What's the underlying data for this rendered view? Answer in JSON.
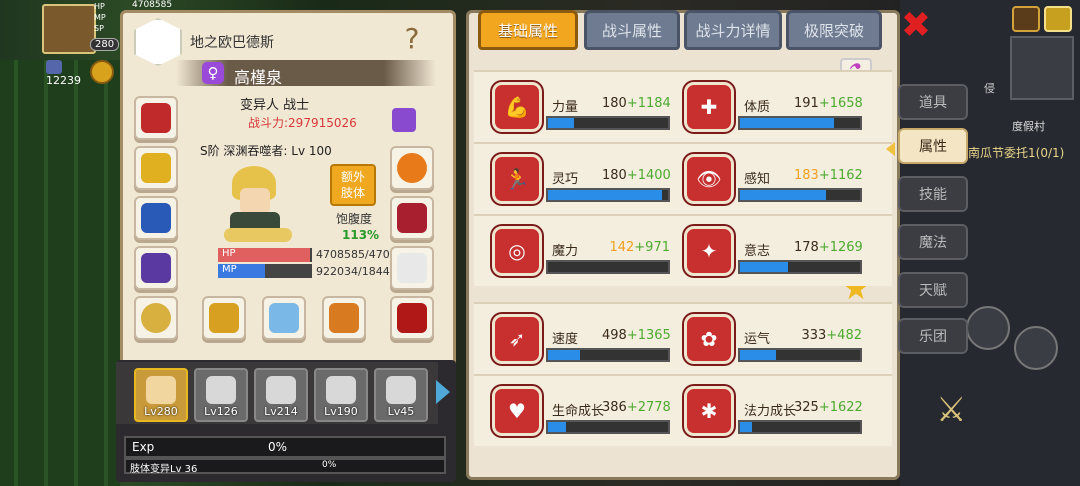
{
  "hud": {
    "hp_label": "HP",
    "mp_label": "MP",
    "sp_label": "SP",
    "hp_value": "4708585",
    "level": "280",
    "gold": "12239"
  },
  "left_panel": {
    "guild_name": "地之欧巴德斯",
    "char_name": "高槿泉",
    "class_line": "变异人 战士",
    "power": "战斗力:297915026",
    "rank_line": "S阶 深渊吞噬者: Lv 100",
    "extra_limb_button": "额外\n肢体",
    "satiety_label": "饱腹度",
    "satiety_value": "113%",
    "hp_text": "4708585/470",
    "mp_text": "922034/1844",
    "hp_label": "HP",
    "mp_label": "MP",
    "hp_fraction": 0.98,
    "mp_fraction": 0.5,
    "exp_label": "Exp",
    "exp_value": "0%",
    "limb_label": "肢体变异Lv 36",
    "limb_value": "0%"
  },
  "characters": [
    {
      "lv": "Lv280"
    },
    {
      "lv": "Lv126"
    },
    {
      "lv": "Lv214"
    },
    {
      "lv": "Lv190"
    },
    {
      "lv": "Lv45"
    }
  ],
  "tabs": [
    "基础属性",
    "战斗属性",
    "战斗力详情",
    "极限突破"
  ],
  "stats": [
    {
      "name": "力量",
      "base": "180",
      "bonus": "+1184",
      "base_color": "normal",
      "fill": 0.22
    },
    {
      "name": "体质",
      "base": "191",
      "bonus": "+1658",
      "base_color": "normal",
      "fill": 0.78
    },
    {
      "name": "灵巧",
      "base": "180",
      "bonus": "+1400",
      "base_color": "normal",
      "fill": 0.95
    },
    {
      "name": "感知",
      "base": "183",
      "bonus": "+1162",
      "base_color": "orange",
      "fill": 0.72
    },
    {
      "name": "魔力",
      "base": "142",
      "bonus": "+971",
      "base_color": "orange",
      "fill": 0.0
    },
    {
      "name": "意志",
      "base": "178",
      "bonus": "+1269",
      "base_color": "normal",
      "fill": 0.4
    },
    {
      "name": "速度",
      "base": "498",
      "bonus": "+1365",
      "base_color": "normal",
      "fill": 0.27
    },
    {
      "name": "运气",
      "base": "333",
      "bonus": "+482",
      "base_color": "normal",
      "fill": 0.3
    },
    {
      "name": "生命成长",
      "base": "386",
      "bonus": "+2778",
      "base_color": "normal",
      "fill": 0.15
    },
    {
      "name": "法力成长",
      "base": "325",
      "bonus": "+1622",
      "base_color": "normal",
      "fill": 0.1
    }
  ],
  "side_menu": [
    "道具",
    "属性",
    "技能",
    "魔法",
    "天赋",
    "乐团"
  ],
  "world": {
    "village": "度假村",
    "quest": "南瓜节委托1(0/1)",
    "npc": "侵"
  },
  "colors": {
    "tab_active": "#f2a51e",
    "tab_inactive": "#6e7b91",
    "stat_icon": "#c83030",
    "bar_fill": "#2a8ee8",
    "bonus_green": "#4caa2e"
  }
}
